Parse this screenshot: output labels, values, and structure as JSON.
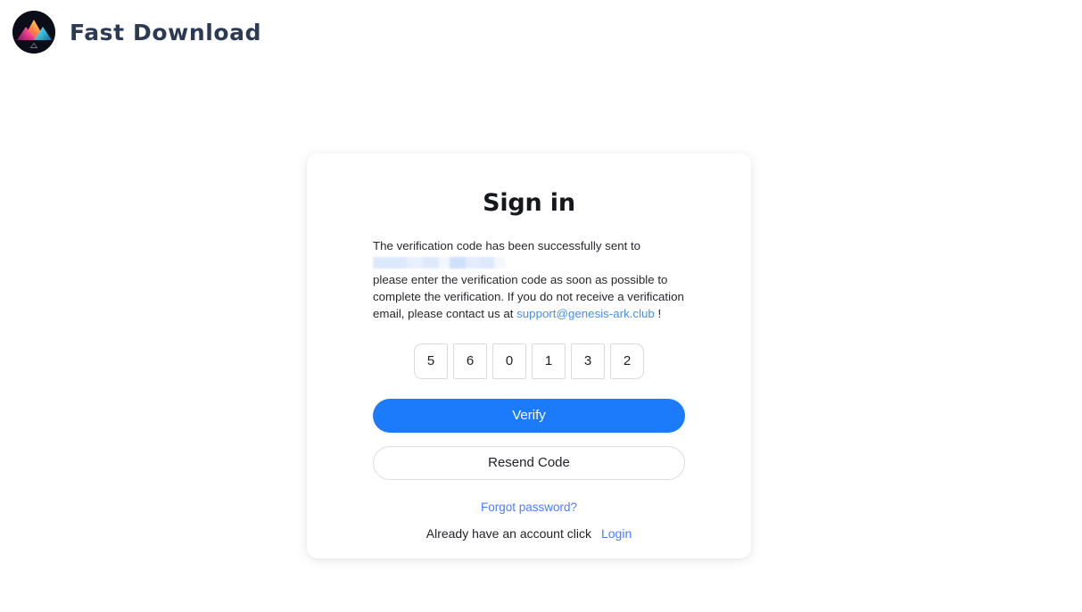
{
  "brand": {
    "logo_icon": "mountain-peak-logo-icon",
    "title": "Fast Download",
    "logo_colors": {
      "circle_bg": "#0b0d18",
      "peak_left": "#f0478f",
      "peak_mid": "#ffb340",
      "peak_right": "#35c6e8"
    }
  },
  "card": {
    "title": "Sign in",
    "message": {
      "line1": "The verification code has been successfully sent to",
      "redacted_email": "",
      "line2_part1": "please enter the verification code as soon as possible to complete the verification. If you do not receive a verification email, please contact us at ",
      "support_email": "support@genesis-ark.club",
      "line2_part2": " !"
    },
    "code": {
      "digits": [
        "5",
        "6",
        "0",
        "1",
        "3",
        "2"
      ]
    },
    "verify_button": "Verify",
    "resend_button": "Resend Code",
    "forgot_password": "Forgot password?",
    "account_prompt": "Already have an account click",
    "login_link": "Login"
  },
  "colors": {
    "primary": "#1b7bfb",
    "link": "#4a7dfc",
    "email_link": "#4a90e2",
    "text": "#1f2024",
    "brand_text": "#2c3a53"
  }
}
